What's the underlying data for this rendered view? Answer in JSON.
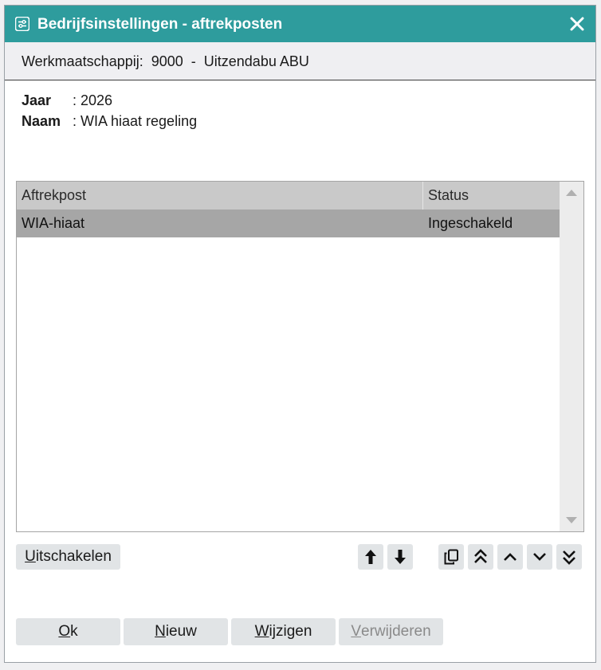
{
  "window": {
    "title": "Bedrijfsinstellingen - aftrekposten",
    "close_glyph": "✕"
  },
  "subheader": {
    "text": "Werkmaatschappij:  9000  -  Uitzendabu ABU"
  },
  "info": {
    "jaar_label": "Jaar",
    "jaar_value": ": 2026",
    "naam_label": "Naam",
    "naam_value": ": WIA hiaat regeling"
  },
  "grid": {
    "columns": [
      "Aftrekpost",
      "Status"
    ],
    "rows": [
      {
        "aftrekpost": "WIA-hiaat",
        "status": "Ingeschakeld",
        "selected": true
      }
    ]
  },
  "actions": {
    "uitschakelen": {
      "first": "U",
      "rest": "itschakelen"
    }
  },
  "icons": {
    "title": "settings-sliders-icon",
    "move_up": "arrow-up-icon",
    "move_down": "arrow-down-icon",
    "copy": "copy-icon",
    "first": "double-chevron-up-icon",
    "previous": "chevron-up-icon",
    "next": "chevron-down-icon",
    "last": "double-chevron-down-icon"
  },
  "footer": {
    "ok": {
      "first": "O",
      "rest": "k"
    },
    "nieuw": {
      "first": "N",
      "rest": "ieuw"
    },
    "wijzigen": {
      "first": "W",
      "rest": "ijzigen"
    },
    "verwijderen": {
      "first": "V",
      "rest": "erwijderen",
      "disabled": true
    }
  },
  "colors": {
    "titlebar": "#2e9c9d",
    "selected_row": "#a6a6a6",
    "grid_header": "#c9c9c9",
    "button": "#e1e4e6"
  }
}
